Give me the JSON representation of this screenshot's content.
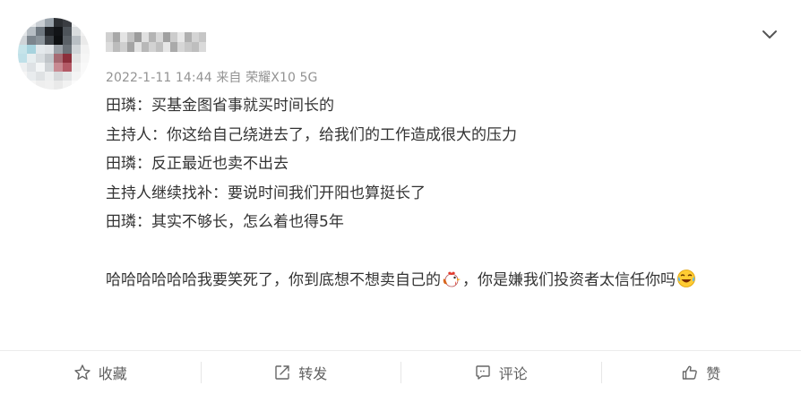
{
  "post": {
    "timestamp": "2022-1-11 14:44",
    "source": "来自 荣耀X10 5G",
    "lines": [
      "田璘：买基金图省事就买时间长的",
      "主持人：你这给自己绕进去了，给我们的工作造成很大的压力",
      "田璘：反正最近也卖不出去",
      "主持人继续找补：要说时间我们开阳也算挺长了",
      "田璘：其实不够长，怎么着也得5年"
    ],
    "comment_part1": "哈哈哈哈哈哈我要笑死了，你到底想不想卖自己的",
    "comment_part2": "，你是嫌我们投资者太信任你吗",
    "emoji_1": "rooster-emoji",
    "emoji_2": "laugh-cry-emoji"
  },
  "actions": {
    "favorite": "收藏",
    "repost": "转发",
    "comment": "评论",
    "like": "赞"
  },
  "colors": {
    "meta": "#939393",
    "text": "#333333",
    "action": "#606060"
  }
}
